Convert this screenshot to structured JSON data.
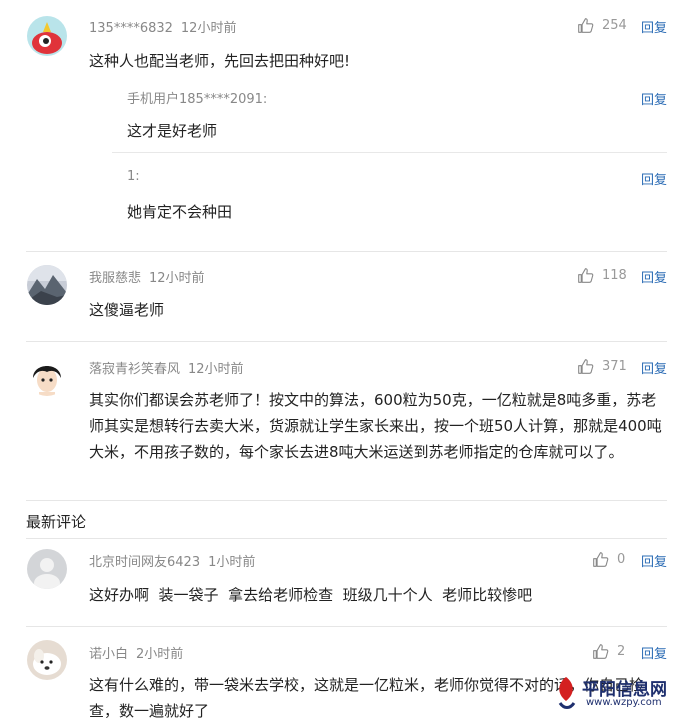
{
  "comments": [
    {
      "user": "135****6832",
      "time": "12小时前",
      "text": "这种人也配当老师，先回去把田种好吧!",
      "likes": "254",
      "reply_label": "回复",
      "avatar": "red-cartoon-monster-avatar",
      "replies": [
        {
          "user": "手机用户185****2091:",
          "text": "这才是好老师",
          "reply_label": "回复"
        },
        {
          "user": "1:",
          "text": "她肯定不会种田",
          "reply_label": "回复"
        }
      ]
    },
    {
      "user": "我服慈悲",
      "time": "12小时前",
      "text": "这傻逼老师",
      "likes": "118",
      "reply_label": "回复",
      "avatar": "mountain-landscape-avatar"
    },
    {
      "user": "落寂青衫笑春风",
      "time": "12小时前",
      "text": "其实你们都误会苏老师了！按文中的算法，600粒为50克，一亿粒就是8吨多重，苏老师其实是想转行去卖大米，货源就让学生家长来出，按一个班50人计算，那就是400吨大米，不用孩子数的，每个家长去进8吨大米运送到苏老师指定的仓库就可以了。",
      "likes": "371",
      "reply_label": "回复",
      "avatar": "anime-boy-avatar"
    }
  ],
  "latest_section_title": "最新评论",
  "latest": [
    {
      "user": "北京时间网友6423",
      "time": "1小时前",
      "text": "这好办啊  装一袋子  拿去给老师检查  班级几十个人  老师比较惨吧",
      "likes": "0",
      "reply_label": "回复",
      "avatar": "default-gray-user-avatar"
    },
    {
      "user": "诺小白",
      "time": "2小时前",
      "text": "这有什么难的，带一袋米去学校，这就是一亿粒米，老师你觉得不对的话，你自己检查，数一遍就好了",
      "likes": "2",
      "reply_label": "回复",
      "avatar": "white-dog-avatar"
    }
  ],
  "watermark": {
    "name": "平阳信息网",
    "url": "www.wzpy.com"
  },
  "colors": {
    "link": "#2b6cb5",
    "meta": "#888888",
    "divider": "#e6e6e6"
  }
}
